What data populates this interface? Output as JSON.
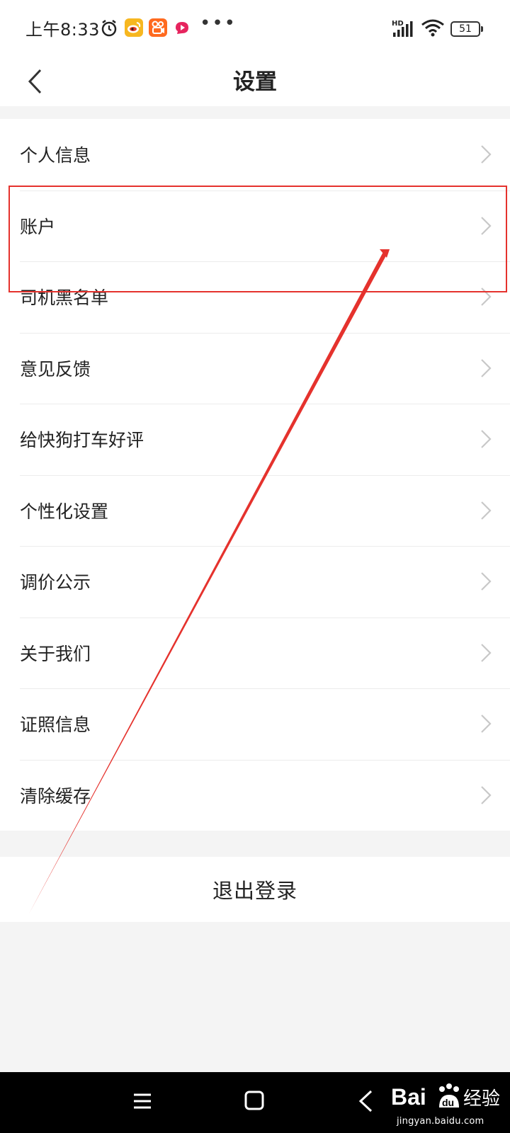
{
  "status_bar": {
    "time": "上午8:33",
    "network_label": "HD",
    "battery_level": "51",
    "icons": [
      "alarm-icon",
      "weibo-icon",
      "kuaishou-icon",
      "mail-icon",
      "more-dots",
      "signal-icon",
      "wifi-icon",
      "battery-icon"
    ]
  },
  "header": {
    "title": "设置",
    "back_icon": "chevron-left-icon"
  },
  "settings": {
    "items": [
      {
        "label": "个人信息"
      },
      {
        "label": "账户"
      },
      {
        "label": "司机黑名单"
      },
      {
        "label": "意见反馈"
      },
      {
        "label": "给快狗打车好评"
      },
      {
        "label": "个性化设置"
      },
      {
        "label": "调价公示"
      },
      {
        "label": "关于我们"
      },
      {
        "label": "证照信息"
      },
      {
        "label": "清除缓存"
      }
    ],
    "item_icon": "chevron-right-icon"
  },
  "logout": {
    "label": "退出登录"
  },
  "annotation": {
    "color": "#e5322d"
  },
  "nav_bar": {
    "icons": [
      "menu-icon",
      "home-icon",
      "back-icon"
    ]
  },
  "watermark": {
    "url": "jingyan.baidu.com"
  },
  "colors": {
    "background": "#f4f4f4",
    "surface": "#ffffff",
    "text": "#222222",
    "chevron": "#c8c8c8",
    "annotation": "#e5322d"
  }
}
